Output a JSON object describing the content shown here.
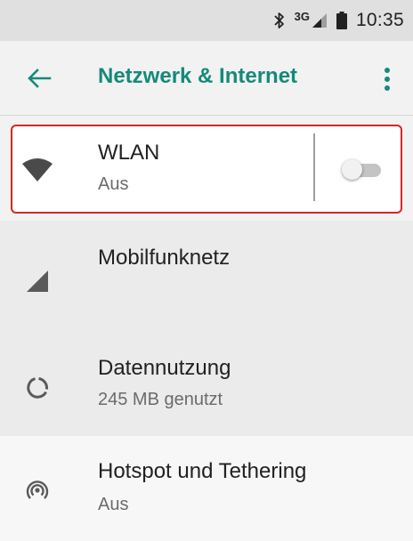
{
  "status_bar": {
    "icons": [
      "bluetooth-icon",
      "mobile-signal-icon",
      "battery-icon"
    ],
    "network_type": "3G",
    "time": "10:35"
  },
  "app_bar": {
    "back_icon": "arrow-back-icon",
    "title": "Netzwerk & Internet",
    "menu_icon": "more-vert-icon",
    "accent_color": "#148a7a"
  },
  "settings": {
    "wlan": {
      "icon": "wifi-icon",
      "title": "WLAN",
      "summary": "Aus",
      "toggle_on": false
    },
    "mobile": {
      "icon": "signal-cellular-icon",
      "title": "Mobilfunknetz"
    },
    "data": {
      "icon": "data-usage-icon",
      "title": "Datennutzung",
      "summary": "245 MB genutzt"
    },
    "hotspot": {
      "icon": "hotspot-icon",
      "title": "Hotspot und Tethering",
      "summary": "Aus"
    }
  },
  "highlight_color": "#d6262a"
}
